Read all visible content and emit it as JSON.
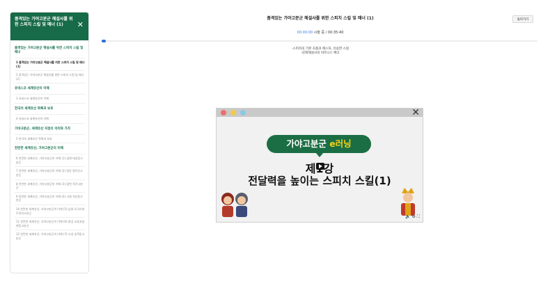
{
  "sidebar": {
    "title": "품격있는 가야고분군 해설사를 위한 스피치 스킬 및 매너 (1)",
    "close_glyph": "✕",
    "sections": [
      {
        "label": "품격있는 가야고분군 해설사를 위한 스피치 스킬 및 매너",
        "items": [
          {
            "label": "1 품격있는 가야고분군 해설사를 위한 스피치 스킬 및 매너 (1)",
            "active": true
          },
          {
            "label": "2 품격있는 가야고분군 해설사를 위한 스피치 스킬 및 매너 (2)",
            "active": false
          }
        ]
      },
      {
        "label": "유네스코 세계유산의 이해",
        "items": [
          {
            "label": "3 유네스코 세계유산의 이해",
            "active": false
          }
        ]
      },
      {
        "label": "한국의 세계유산 목록과 보호",
        "items": [
          {
            "label": "4 유네스코 세계유산의 이해",
            "active": false
          }
        ]
      },
      {
        "label": "가야고분군, 세계유산 지정의 의미와 가치",
        "items": [
          {
            "label": "5 한국의 세계유산 목록과 보호",
            "active": false
          }
        ]
      },
      {
        "label": "찬란한 세계유산, 가야고분군의 이해",
        "items": [
          {
            "label": "6 찬란한 세계유산, 가야고분군의 이해 (1)-김해 대성동고분군",
            "active": false
          },
          {
            "label": "7 찬란한 세계유산, 가야고분군의 이해 (2)-함안 말이산고분군",
            "active": false
          },
          {
            "label": "8 찬란한 세계유산, 가야고분군의 이해 (3)-합천 옥전고분군",
            "active": false
          },
          {
            "label": "9 찬란한 세계유산, 가야고분군의 이해 (4)-고령 지산동고분군",
            "active": false
          },
          {
            "label": "10 찬란한 세계유산, 가야고분군의 이해 (5)-남원 유곡리와두락리고분군",
            "active": false
          },
          {
            "label": "11 찬란한 세계유산, 가야고분군의 이해 (6)-창녕 교동과송현동고분군",
            "active": false
          },
          {
            "label": "12 찬란한 세계유산, 가야고분군의 이해 (7)-고성 송학동고분군",
            "active": false
          }
        ]
      }
    ]
  },
  "header": {
    "title": "품격있는 가야고분군 해설사를 위한 스피치 스킬 및 매너 (1)",
    "back_label": "돌아가기"
  },
  "player": {
    "current_time": "00:00:00",
    "time_sep": "시청 중 /",
    "total_time": "00:35:40",
    "progress": 0.0
  },
  "description": {
    "line1": "-스피치의 기본 호흡과 제스처, 유용한 스킬",
    "line2": "-문화해설사의 비즈니스 매너"
  },
  "video": {
    "window_dot_colors": [
      "#f16c6c",
      "#f2c94c",
      "#88c9e8"
    ],
    "close_glyph": "✕",
    "banner_white": "가야고분군 ",
    "banner_yellow": "e러닝",
    "lecture_no": "제1강",
    "lecture_title": "전달력을 높이는 스피치 스킬(1)",
    "controls": "🔈 ⚙ ⛶"
  }
}
